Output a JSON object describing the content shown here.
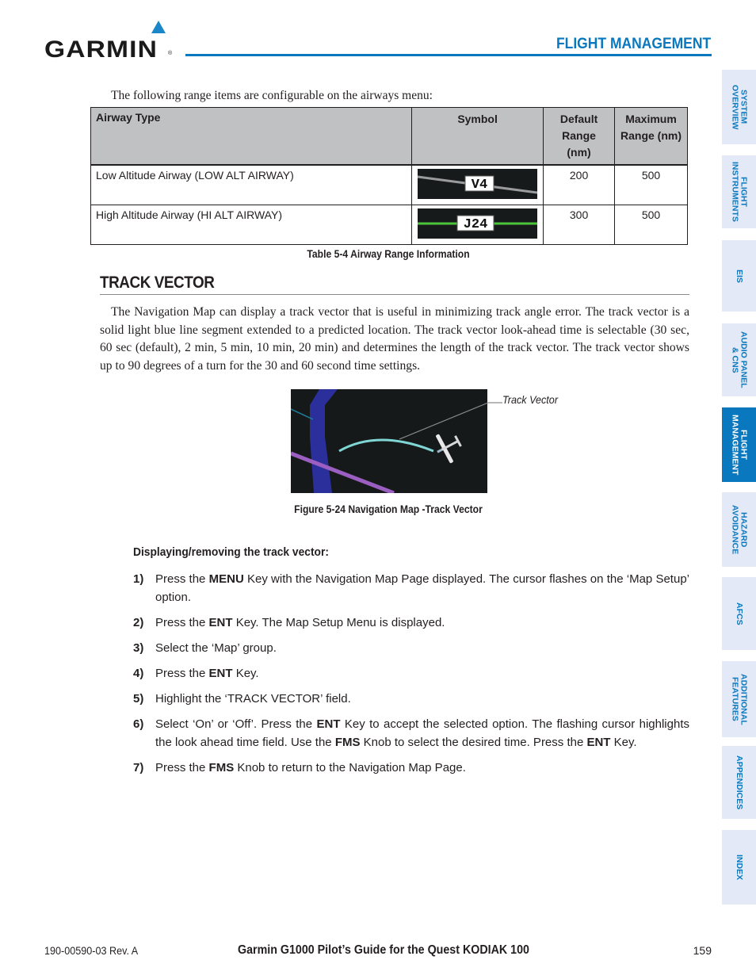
{
  "header": {
    "brand": "GARMIN",
    "brand_mark": "®",
    "section_title": "FLIGHT MANAGEMENT",
    "accent_color": "#0a78be"
  },
  "side_tabs": [
    {
      "label": "SYSTEM\nOVERVIEW",
      "active": false
    },
    {
      "label": "FLIGHT\nINSTRUMENTS",
      "active": false
    },
    {
      "label": "EIS",
      "active": false
    },
    {
      "label": "AUDIO PANEL\n& CNS",
      "active": false
    },
    {
      "label": "FLIGHT\nMANAGEMENT",
      "active": true
    },
    {
      "label": "HAZARD\nAVOIDANCE",
      "active": false
    },
    {
      "label": "AFCS",
      "active": false
    },
    {
      "label": "ADDITIONAL\nFEATURES",
      "active": false
    },
    {
      "label": "APPENDICES",
      "active": false
    },
    {
      "label": "INDEX",
      "active": false
    }
  ],
  "intro": "The following range items are configurable on the airways menu:",
  "table": {
    "headers": [
      "Airway Type",
      "Symbol",
      "Default Range (nm)",
      "Maximum Range (nm)"
    ],
    "header_default_lines": [
      "Default",
      "Range (nm)"
    ],
    "header_max_lines": [
      "Maximum",
      "Range (nm)"
    ],
    "rows": [
      {
        "type": "Low Altitude Airway (LOW ALT AIRWAY)",
        "symbol_label": "V4",
        "symbol_icon": "low-altitude-airway-symbol",
        "default": "200",
        "max": "500"
      },
      {
        "type": "High Altitude Airway (HI ALT AIRWAY)",
        "symbol_label": "J24",
        "symbol_icon": "high-altitude-airway-symbol",
        "default": "300",
        "max": "500"
      }
    ],
    "caption": "Table 5-4  Airway Range Information"
  },
  "section": {
    "heading": "TRACK VECTOR",
    "paragraph": "The Navigation Map can display a track vector that  is useful in minimizing track angle error.  The track vector is a solid light blue line segment extended to a predicted location.  The track vector look-ahead time is selectable (30 sec, 60 sec (default), 2 min, 5 min, 10 min, 20 min) and determines the length of the track vector. The track vector shows up to 90 degrees of a turn for the 30 and 60 second time settings."
  },
  "figure": {
    "callout": "Track Vector",
    "caption": "Figure 5-24  Navigation Map -Track Vector"
  },
  "procedure": {
    "title": "Displaying/removing the track vector:",
    "steps": [
      {
        "num": "1)",
        "parts": [
          [
            "Press the ",
            false
          ],
          [
            "MENU",
            true
          ],
          [
            " Key with the Navigation Map Page displayed.  The cursor flashes on the ‘Map Setup’ option.",
            false
          ]
        ]
      },
      {
        "num": "2)",
        "parts": [
          [
            "Press the ",
            false
          ],
          [
            "ENT",
            true
          ],
          [
            " Key.  The Map Setup Menu is displayed.",
            false
          ]
        ]
      },
      {
        "num": "3)",
        "parts": [
          [
            "Select the ‘Map’ group.",
            false
          ]
        ]
      },
      {
        "num": "4)",
        "parts": [
          [
            "Press the ",
            false
          ],
          [
            "ENT",
            true
          ],
          [
            " Key.",
            false
          ]
        ]
      },
      {
        "num": "5)",
        "parts": [
          [
            "Highlight the ‘TRACK VECTOR’ field.",
            false
          ]
        ]
      },
      {
        "num": "6)",
        "parts": [
          [
            "Select ‘On’ or ‘Off’.  Press the ",
            false
          ],
          [
            "ENT",
            true
          ],
          [
            " Key to accept the selected option.  The flashing cursor highlights the look ahead time field.  Use the ",
            false
          ],
          [
            "FMS",
            true
          ],
          [
            " Knob to select the desired time.  Press the ",
            false
          ],
          [
            "ENT",
            true
          ],
          [
            " Key.",
            false
          ]
        ]
      },
      {
        "num": "7)",
        "parts": [
          [
            "Press the ",
            false
          ],
          [
            "FMS",
            true
          ],
          [
            " Knob to return to the Navigation Map Page.",
            false
          ]
        ]
      }
    ]
  },
  "footer": {
    "doc_number": "190-00590-03  Rev. A",
    "title": "Garmin G1000 Pilot’s Guide for the Quest KODIAK 100",
    "page": "159"
  }
}
